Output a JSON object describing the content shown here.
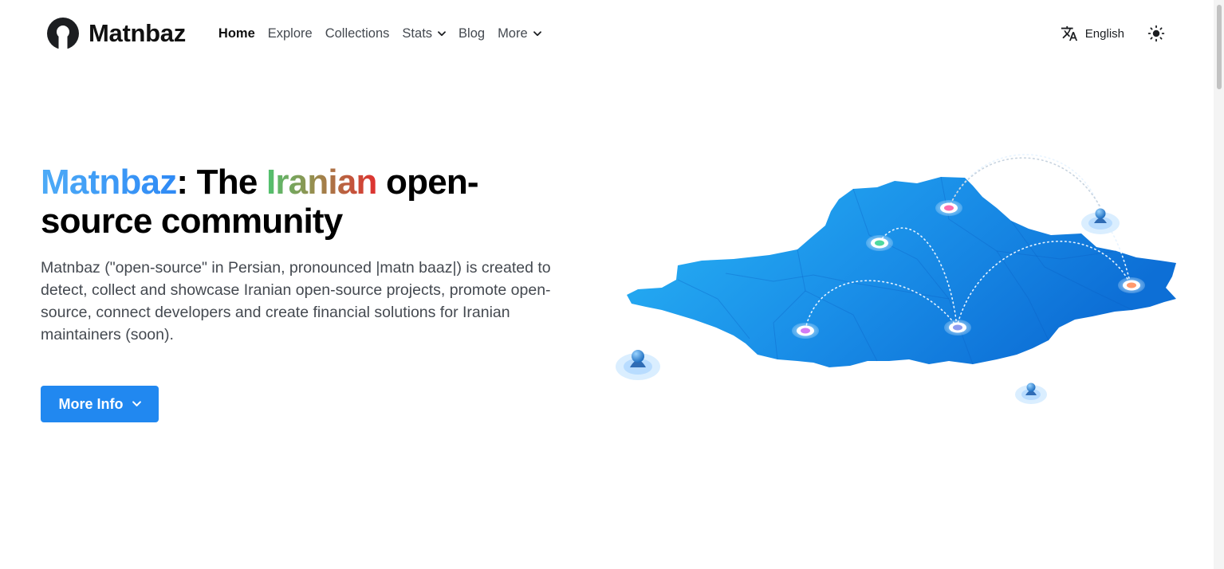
{
  "navbar": {
    "brand": "Matnbaz",
    "links": [
      {
        "label": "Home",
        "active": true
      },
      {
        "label": "Explore"
      },
      {
        "label": "Collections"
      },
      {
        "label": "Stats",
        "dropdown": true
      },
      {
        "label": "Blog"
      },
      {
        "label": "More",
        "dropdown": true
      }
    ],
    "language": "English",
    "icons": {
      "language": "translate-icon",
      "theme": "sun-icon",
      "logo": "matnbaz-logo"
    }
  },
  "hero": {
    "title_brand": "Matnbaz",
    "title_sep": ": The ",
    "title_highlight": "Iranian",
    "title_rest": " open-source community",
    "description": "Matnbaz (\"open-source\" in Persian, pronounced |matn baaz|) is created to detect, collect and showcase Iranian open-source projects, promote open-source, connect developers and create financial solutions for Iranian maintainers (soon).",
    "button_label": "More Info"
  },
  "colors": {
    "accent": "#2188f0",
    "brand_gradient": [
      "#4dabf7",
      "#2f8af5"
    ],
    "iranian_gradient": [
      "#4fc36f",
      "#e02f2f"
    ],
    "map_blue": "#1a8fe8"
  }
}
